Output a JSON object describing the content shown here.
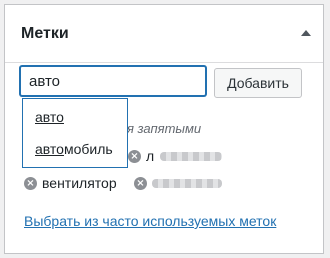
{
  "panel": {
    "title": "Метки",
    "toggle_icon": "triangle-up-icon"
  },
  "input": {
    "value": "авто"
  },
  "add_button": {
    "label": "Добавить"
  },
  "hint": {
    "text": "ются запятыми"
  },
  "suggestions": [
    {
      "match": "авто",
      "rest": ""
    },
    {
      "match": "авто",
      "rest": "мобиль"
    }
  ],
  "tags": [
    {
      "label": "л",
      "remove_icon": "remove-circle-icon"
    },
    {
      "label": "вентилятор",
      "remove_icon": "remove-circle-icon"
    },
    {
      "label": "",
      "remove_icon": "remove-circle-icon"
    }
  ],
  "choose_link": {
    "text": "Выбрать из часто используемых меток"
  },
  "colors": {
    "accent": "#2271b1",
    "remove_icon": "#8c8f94",
    "border": "#c3c4c7"
  }
}
